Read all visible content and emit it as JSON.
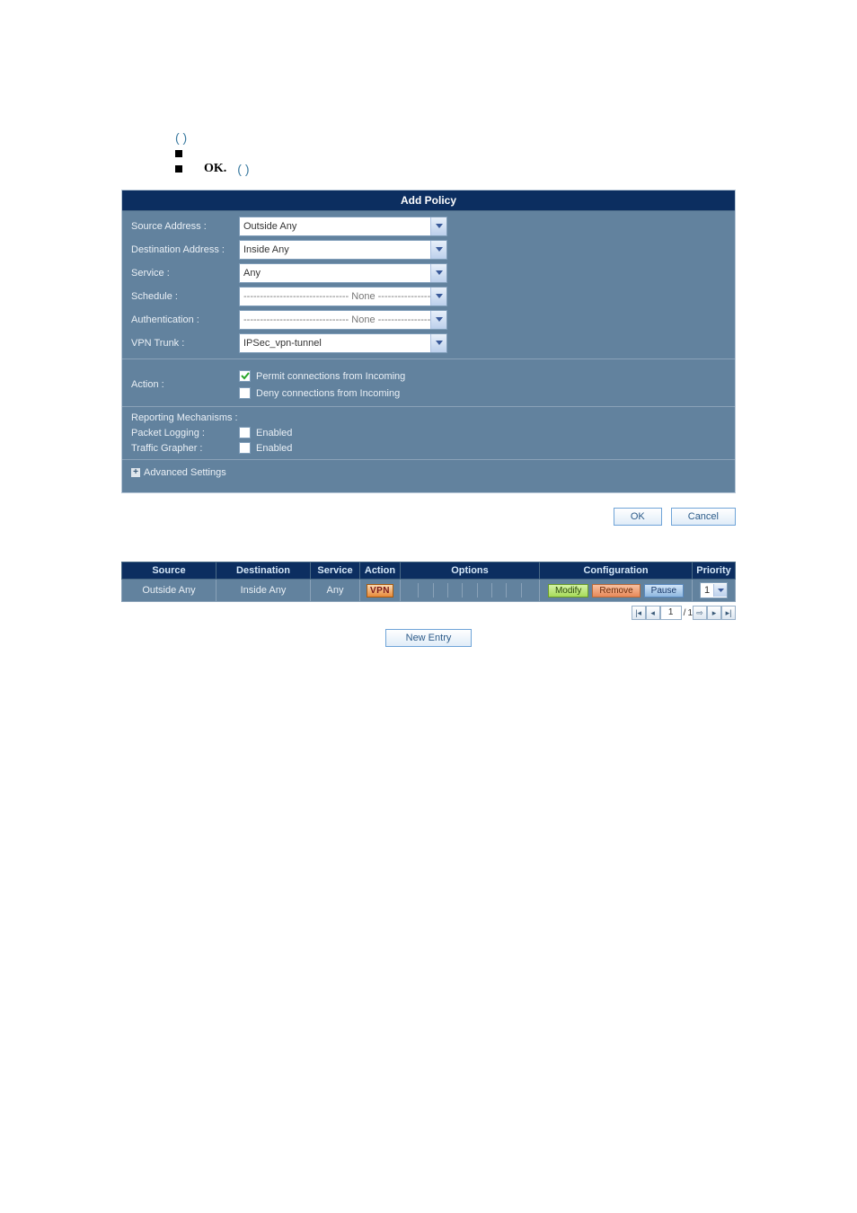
{
  "intro": {
    "paren_top": "(                    )",
    "bullet1_text": " ",
    "bullet2_prefix": " ",
    "ok_text": "OK.",
    "paren_bottom": " (                      )"
  },
  "panel_title": "Add Policy",
  "form": {
    "source_label": "Source Address :",
    "source_value": "Outside Any",
    "dest_label": "Destination Address :",
    "dest_value": "Inside Any",
    "service_label": "Service :",
    "service_value": "Any",
    "schedule_label": "Schedule :",
    "schedule_value": "-------------------------------- None -----------------------------",
    "auth_label": "Authentication :",
    "auth_value": "-------------------------------- None -----------------------------",
    "trunk_label": "VPN Trunk :",
    "trunk_value": "IPSec_vpn-tunnel"
  },
  "action": {
    "label": "Action :",
    "permit_checked": true,
    "permit_label": "Permit connections from Incoming",
    "deny_checked": false,
    "deny_label": "Deny connections from Incoming"
  },
  "reporting": {
    "heading": "Reporting Mechanisms :",
    "packet_label": "Packet Logging :",
    "packet_checked": false,
    "packet_text": "Enabled",
    "grapher_label": "Traffic Grapher :",
    "grapher_checked": false,
    "grapher_text": "Enabled"
  },
  "advanced_label": "Advanced Settings",
  "buttons": {
    "ok": "OK",
    "cancel": "Cancel",
    "new_entry": "New Entry"
  },
  "list": {
    "headers": {
      "source": "Source",
      "destination": "Destination",
      "service": "Service",
      "action": "Action",
      "options": "Options",
      "configuration": "Configuration",
      "priority": "Priority"
    },
    "row": {
      "source": "Outside Any",
      "destination": "Inside Any",
      "service": "Any",
      "action_badge": "VPN",
      "cfg_modify": "Modify",
      "cfg_remove": "Remove",
      "cfg_pause": "Pause",
      "priority": "1"
    }
  },
  "pager": {
    "page": "1",
    "total": "1"
  }
}
